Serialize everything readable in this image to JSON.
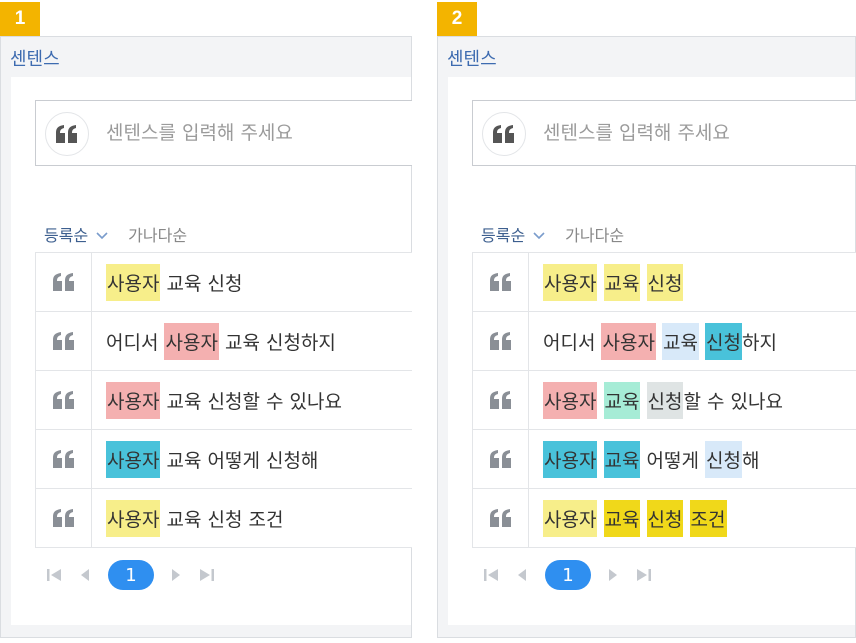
{
  "panels": [
    {
      "badge": "1",
      "title": "센텐스",
      "search_placeholder": "센텐스를 입력해 주세요",
      "sort": {
        "active": "등록순",
        "alt": "가나다순"
      },
      "rows": [
        {
          "tokens": [
            {
              "text": "사용자",
              "color": "#f7ee8a"
            },
            {
              "text": " 교육 신청",
              "color": ""
            }
          ]
        },
        {
          "tokens": [
            {
              "text": "어디서 ",
              "color": ""
            },
            {
              "text": "사용자",
              "color": "#f4b0b0"
            },
            {
              "text": " 교육 신청하지",
              "color": ""
            }
          ]
        },
        {
          "tokens": [
            {
              "text": "사용자",
              "color": "#f4b0b0"
            },
            {
              "text": " 교육 신청할 수 있나요",
              "color": ""
            }
          ]
        },
        {
          "tokens": [
            {
              "text": "사용자",
              "color": "#49c2da"
            },
            {
              "text": " 교육 어떻게 신청해",
              "color": ""
            }
          ]
        },
        {
          "tokens": [
            {
              "text": "사용자",
              "color": "#f7ee8a"
            },
            {
              "text": " 교육 신청 조건",
              "color": ""
            }
          ]
        }
      ],
      "pager": {
        "current": "1"
      }
    },
    {
      "badge": "2",
      "title": "센텐스",
      "search_placeholder": "센텐스를 입력해 주세요",
      "sort": {
        "active": "등록순",
        "alt": "가나다순"
      },
      "rows": [
        {
          "tokens": [
            {
              "text": "사용자",
              "color": "#f7ee8a"
            },
            {
              "text": " ",
              "color": ""
            },
            {
              "text": "교육",
              "color": "#f7ee8a"
            },
            {
              "text": " ",
              "color": ""
            },
            {
              "text": "신청",
              "color": "#f7ee8a"
            }
          ]
        },
        {
          "tokens": [
            {
              "text": "어디서 ",
              "color": ""
            },
            {
              "text": "사용자",
              "color": "#f4b0b0"
            },
            {
              "text": " ",
              "color": ""
            },
            {
              "text": "교육",
              "color": "#d8e9f9"
            },
            {
              "text": " ",
              "color": ""
            },
            {
              "text": "신청",
              "color": "#49c2da"
            },
            {
              "text": "하지",
              "color": ""
            }
          ]
        },
        {
          "tokens": [
            {
              "text": "사용자",
              "color": "#f4b0b0"
            },
            {
              "text": " ",
              "color": ""
            },
            {
              "text": "교육",
              "color": "#a6ecd6"
            },
            {
              "text": " ",
              "color": ""
            },
            {
              "text": "신청",
              "color": "#dfe4e4"
            },
            {
              "text": "할 수 있나요",
              "color": ""
            }
          ]
        },
        {
          "tokens": [
            {
              "text": "사용자",
              "color": "#49c2da"
            },
            {
              "text": " ",
              "color": ""
            },
            {
              "text": "교육",
              "color": "#49c2da"
            },
            {
              "text": " 어떻게 ",
              "color": ""
            },
            {
              "text": "신청",
              "color": "#d8e9f9"
            },
            {
              "text": "해",
              "color": ""
            }
          ]
        },
        {
          "tokens": [
            {
              "text": "사용자",
              "color": "#f7ee8a"
            },
            {
              "text": " ",
              "color": ""
            },
            {
              "text": "교육",
              "color": "#f0d81a"
            },
            {
              "text": " ",
              "color": ""
            },
            {
              "text": "신청",
              "color": "#f0d81a"
            },
            {
              "text": " ",
              "color": ""
            },
            {
              "text": "조건",
              "color": "#f0d81a"
            }
          ]
        }
      ],
      "pager": {
        "current": "1"
      }
    }
  ]
}
